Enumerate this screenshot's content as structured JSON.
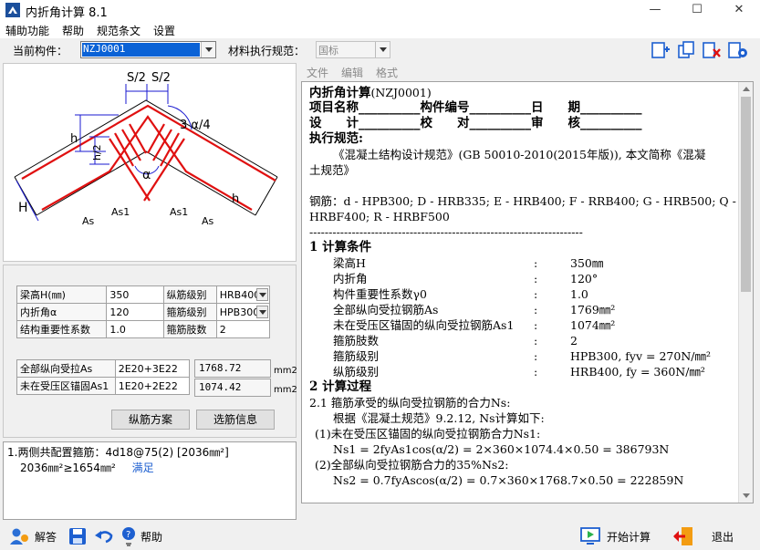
{
  "window": {
    "title": "内折角计算 8.1",
    "minimize": "—",
    "maximize": "☐",
    "close": "✕"
  },
  "menu": [
    "辅助功能",
    "帮助",
    "规范条文",
    "设置"
  ],
  "toolbar": {
    "component_label": "当前构件：",
    "component_value": "NZJ0001",
    "code_label": "材料执行规范：",
    "code_value": "国标"
  },
  "diagram_labels": {
    "s2a": "S/2",
    "s2b": "S/2",
    "a4": "3 α/4",
    "h1": "h",
    "h2": "h/2",
    "h3": "h",
    "H": "H",
    "alpha": "α",
    "As_left": "As",
    "As1_left": "As1",
    "As1_right": "As1",
    "As_right": "As"
  },
  "params": [
    {
      "label": "梁高H(㎜)",
      "value": "350",
      "label2": "纵筋级别",
      "value2": "HRB400"
    },
    {
      "label": "内折角α",
      "value": "120",
      "label2": "箍筋级别",
      "value2": "HPB300"
    },
    {
      "label": "结构重要性系数",
      "value": "1.0",
      "label2": "箍筋肢数",
      "value2": "2"
    }
  ],
  "reinforcement": [
    {
      "label": "全部纵向受拉As",
      "value": "2E20+3E22",
      "result": "1768.72",
      "unit": "mm2"
    },
    {
      "label": "未在受压区锚固As1",
      "value": "1E20+2E22",
      "result": "1074.42",
      "unit": "mm2"
    }
  ],
  "buttons": {
    "scheme": "纵筋方案",
    "select": "选筋信息"
  },
  "result": {
    "line1": "1.两侧共配置箍筋：4d18@75(2) [2036㎜²]",
    "line2": "2036㎜²≥1654㎜²",
    "ok": "满足"
  },
  "doc_menu": [
    "文件",
    "编辑",
    "格式"
  ],
  "doc": {
    "title": "内折角计算",
    "title_id": "(NZJ0001)",
    "header1": "项目名称__________构件编号__________日　　期__________",
    "header2": "设　　计__________校　　对__________审　　核__________",
    "code_head": "执行规范:",
    "code_text1": "《混凝土结构设计规范》(GB 50010-2010(2015年版)), 本文简称《混凝",
    "code_text2": "土规范》",
    "steel1": "钢筋：d - HPB300; D - HRB335; E - HRB400; F - RRB400; G - HRB500; Q -",
    "steel2": "HRBF400; R - HRBF500",
    "divider": "-----------------------------------------------------------------------",
    "sec1": "1 计算条件",
    "conditions": [
      {
        "k": "梁高H",
        "v": "350㎜"
      },
      {
        "k": "内折角",
        "v": "120°"
      },
      {
        "k": "构件重要性系数γ0",
        "v": "1.0"
      },
      {
        "k": "全部纵向受拉钢筋As",
        "v": "1769㎜²"
      },
      {
        "k": "未在受压区锚固的纵向受拉钢筋As1",
        "v": "1074㎜²"
      },
      {
        "k": "箍筋肢数",
        "v": "2"
      },
      {
        "k": "箍筋级别",
        "v": "HPB300, fyv = 270N/㎜²"
      },
      {
        "k": "纵筋级别",
        "v": "HRB400, fy = 360N/㎜²"
      }
    ],
    "sec2": "2 计算过程",
    "p21": "2.1 箍筋承受的纵向受拉钢筋的合力Ns:",
    "p21a": "根据《混凝土规范》9.2.12, Ns计算如下:",
    "p21b": "(1)未在受压区锚固的纵向受拉钢筋合力Ns1:",
    "p21c": "Ns1 = 2fyAs1cos(α/2) = 2×360×1074.4×0.50 = 386793N",
    "p21d": "(2)全部纵向受拉钢筋合力的35%Ns2:",
    "p21e": "Ns2 = 0.7fyAscos(α/2) = 0.7×360×1768.7×0.50 = 222859N"
  },
  "bottom": {
    "answer": "解答",
    "help": "帮助",
    "start": "开始计算",
    "exit": "退出"
  },
  "colors": {
    "rebar": "#e01010",
    "dim": "#1a1ad0",
    "accent": "#1d5fd0"
  }
}
